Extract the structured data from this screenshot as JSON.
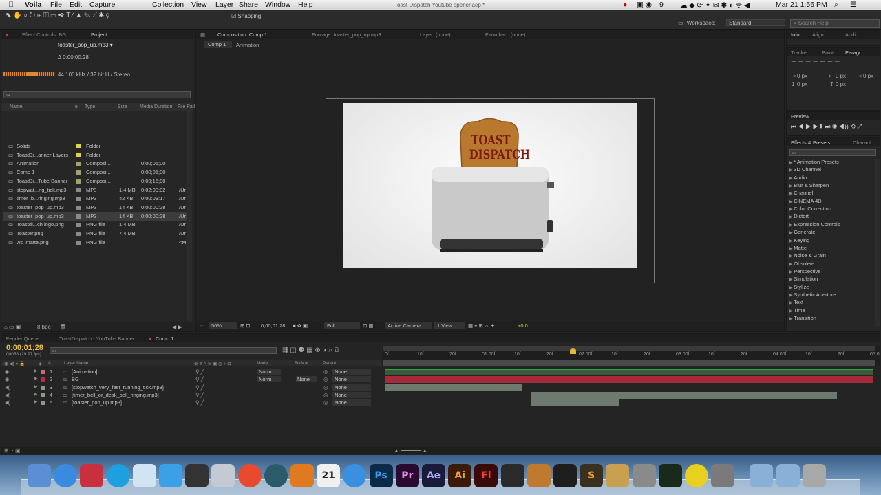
{
  "menubar": {
    "apple_icon": "apple-icon",
    "app_name": "Voila",
    "menus": [
      "File",
      "Edit",
      "Capture",
      "Collection",
      "View",
      "Layer",
      "Share",
      "Window",
      "Help"
    ],
    "status": "9",
    "date_time": "Mar 21  1:56 PM",
    "window_title": "Toast Dispatch Youtube opener.aep *"
  },
  "toolbar": {
    "snapping_label": "Snapping",
    "workspace_label": "Workspace:",
    "workspace_value": "Standard",
    "search_placeholder": "Search Help"
  },
  "project_panel": {
    "tabs": [
      "Effect Controls: BG",
      "Project"
    ],
    "selected_name": "toaster_pop_up.mp3 ▾",
    "duration": "Δ 0:00:00:28",
    "audio_info": "44.100 kHz / 32 bit U / Stereo",
    "columns": [
      "Name",
      "Type",
      "Size",
      "Media Duration",
      "File Path"
    ],
    "items": [
      {
        "name": "Solids",
        "type": "Folder",
        "size": "",
        "duration": "",
        "path": "",
        "color": "#d8d84a"
      },
      {
        "name": "ToastDi...anner Layers",
        "type": "Folder",
        "size": "",
        "duration": "",
        "path": "",
        "color": "#d8d84a"
      },
      {
        "name": "Animation",
        "type": "Composi...",
        "size": "",
        "duration": "0;00;05;00",
        "path": "",
        "color": "#a0a070"
      },
      {
        "name": "Comp 1",
        "type": "Composi...",
        "size": "",
        "duration": "0;00;05;00",
        "path": "",
        "color": "#a0a070"
      },
      {
        "name": "ToastDi...Tube Banner",
        "type": "Composi...",
        "size": "",
        "duration": "0;00;15;00",
        "path": "",
        "color": "#a0a070"
      },
      {
        "name": "stopwat...ng_tick.mp3",
        "type": "MP3",
        "size": "1.4 MB",
        "duration": "0:02:00:02",
        "path": "/Ur",
        "color": "#8a8a8a"
      },
      {
        "name": "timer_b...ringing.mp3",
        "type": "MP3",
        "size": "42 KB",
        "duration": "0:00:03:17",
        "path": "/Ur",
        "color": "#8a8a8a"
      },
      {
        "name": "toaster_pop_up.mp3",
        "type": "MP3",
        "size": "14 KB",
        "duration": "0:00:00:28",
        "path": "/Ur",
        "color": "#8a8a8a"
      },
      {
        "name": "toaster_pop_up.mp3",
        "type": "MP3",
        "size": "14 KB",
        "duration": "0:00:00:28",
        "path": "/Ur",
        "color": "#8a8a8a"
      },
      {
        "name": "Toastdi...ch logo.png",
        "type": "PNG file",
        "size": "1.4 MB",
        "duration": "",
        "path": "/Ur",
        "color": "#8a8a8a"
      },
      {
        "name": "Toaster.png",
        "type": "PNG file",
        "size": "7.4 MB",
        "duration": "",
        "path": "/Ur",
        "color": "#8a8a8a"
      },
      {
        "name": "ws_matte.png",
        "type": "PNG file",
        "size": "",
        "duration": "",
        "path": "<M",
        "color": "#8a8a8a"
      }
    ],
    "bpc": "8 bpc"
  },
  "comp_panel": {
    "tabs": [
      "Composition: Comp 1",
      "Footage: toaster_pop_up.mp3",
      "Layer: (none)",
      "Flowchart: (none)"
    ],
    "sub_tabs": [
      "Comp 1",
      "Animation"
    ],
    "toast_text": "TOAST DISPATCH",
    "zoom": "50%",
    "timecode": "0;00;01;28",
    "resolution": "Full",
    "camera": "Active Camera",
    "view": "1 View",
    "exposure": "+0.0"
  },
  "right_panel": {
    "info_tabs": [
      "Info",
      "Align",
      "Audio"
    ],
    "para_tabs": [
      "Tracker",
      "Paint",
      "Paragr"
    ],
    "px_values": [
      "0 px",
      "0 px",
      "0 px",
      "0 px",
      "0 px"
    ],
    "preview_tab": "Preview",
    "effects_tabs": [
      "Effects & Presets",
      "Charact"
    ],
    "effects": [
      "* Animation Presets",
      "3D Channel",
      "Audio",
      "Blur & Sharpen",
      "Channel",
      "CINEMA 4D",
      "Color Correction",
      "Distort",
      "Expression Controls",
      "Generate",
      "Keying",
      "Matte",
      "Noise & Grain",
      "Obsolete",
      "Perspective",
      "Simulation",
      "Stylize",
      "Synthetic Aperture",
      "Text",
      "Time",
      "Transition"
    ]
  },
  "timeline": {
    "tabs": [
      "Render Queue",
      "ToastDispatch - YouTube Banner",
      "Comp 1"
    ],
    "timecode": "0;00;01;28",
    "frame_info": "00058 (29.97 fps)",
    "col_headers": [
      "#",
      "Layer Name",
      "Mode",
      "TrkMat",
      "Parent"
    ],
    "ruler": [
      "0f",
      "10f",
      "20f",
      "01:00f",
      "10f",
      "20f",
      "02:00f",
      "10f",
      "20f",
      "03:00f",
      "10f",
      "20f",
      "04:00f",
      "10f",
      "20f",
      "05:0"
    ],
    "layers": [
      {
        "num": "1",
        "name": "[Animation]",
        "mode": "Norm",
        "trkmat": "",
        "parent": "None",
        "color": "#c07070"
      },
      {
        "num": "2",
        "name": "BG",
        "mode": "Norm",
        "trkmat": "None",
        "parent": "None",
        "color": "#b03040"
      },
      {
        "num": "3",
        "name": "[stopwatch_very_fast_running_tick.mp3]",
        "mode": "",
        "trkmat": "",
        "parent": "None",
        "color": "#8c9a8c"
      },
      {
        "num": "4",
        "name": "[timer_bell_or_desk_bell_ringing.mp3]",
        "mode": "",
        "trkmat": "",
        "parent": "None",
        "color": "#8c9a8c"
      },
      {
        "num": "5",
        "name": "[toaster_pop_up.mp3]",
        "mode": "",
        "trkmat": "",
        "parent": "None",
        "color": "#8c9a8c"
      }
    ]
  },
  "dock": {
    "icons": [
      "finder-icon",
      "app-store-icon",
      "voila-icon",
      "skype-icon",
      "messages-icon",
      "twitter-icon",
      "server-icon",
      "preview-icon",
      "chrome-icon",
      "clock-icon",
      "firefox-icon",
      "calendar-icon",
      "itunes-icon",
      "photoshop-icon",
      "premiere-icon",
      "after-effects-icon",
      "illustrator-icon",
      "flash-icon",
      "photo-icon",
      "screenshot-icon",
      "frame-icon",
      "sublime-icon",
      "box-icon",
      "system-prefs-icon",
      "activity-icon",
      "ball-icon",
      "pencil-icon",
      "folder-icon",
      "folder2-icon",
      "trash-icon"
    ],
    "calendar_day": "21",
    "labels": {
      "ps": "Ps",
      "pr": "Pr",
      "ae": "Ae",
      "ai": "Ai",
      "fl": "Fl"
    }
  }
}
